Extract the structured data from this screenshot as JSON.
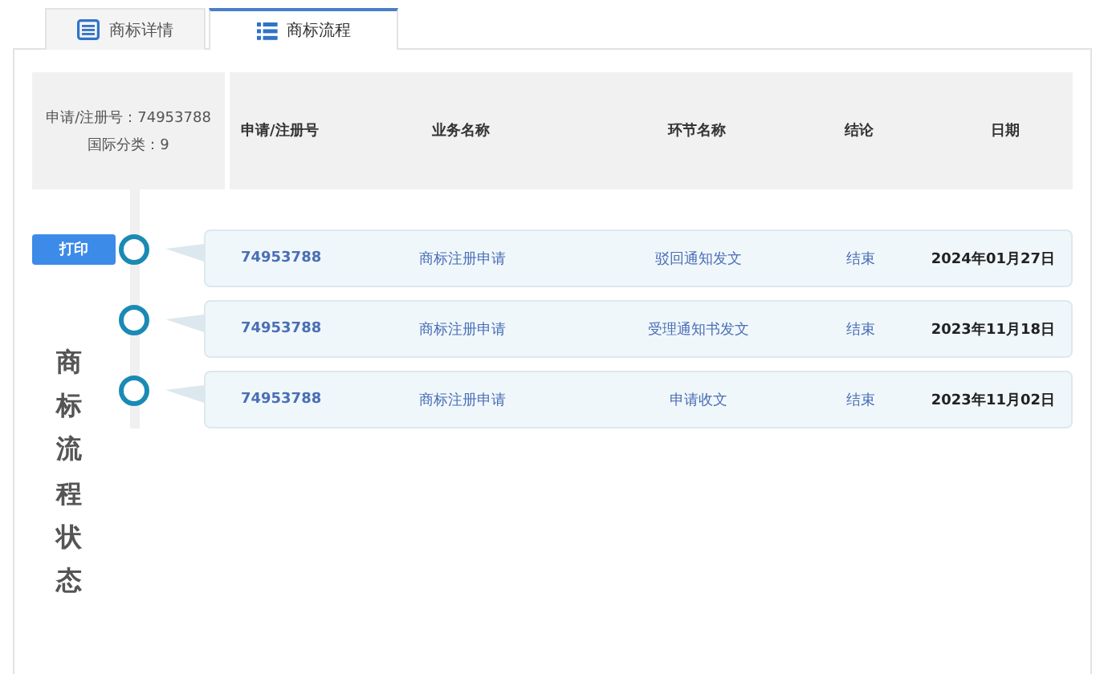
{
  "tabs": [
    {
      "label": "商标详情",
      "selected": false
    },
    {
      "label": "商标流程",
      "selected": true
    }
  ],
  "summary": {
    "registration_number": "申请/注册号：74953788",
    "international_class": "国际分类：9"
  },
  "table": {
    "columns": [
      "申请/注册号",
      "业务名称",
      "环节名称",
      "结论",
      "日期"
    ],
    "rows": [
      {
        "print_button": "打印",
        "cells": [
          "74953788",
          "商标注册申请",
          "驳回通知发文",
          "结束",
          "2024年01月27日"
        ]
      },
      {
        "cells": [
          "74953788",
          "商标注册申请",
          "受理通知书发文",
          "结束",
          "2023年11月18日"
        ]
      },
      {
        "cells": [
          "74953788",
          "商标注册申请",
          "申请收文",
          "结束",
          "2023年11月02日"
        ]
      }
    ]
  },
  "side_label": "商标流程状态"
}
